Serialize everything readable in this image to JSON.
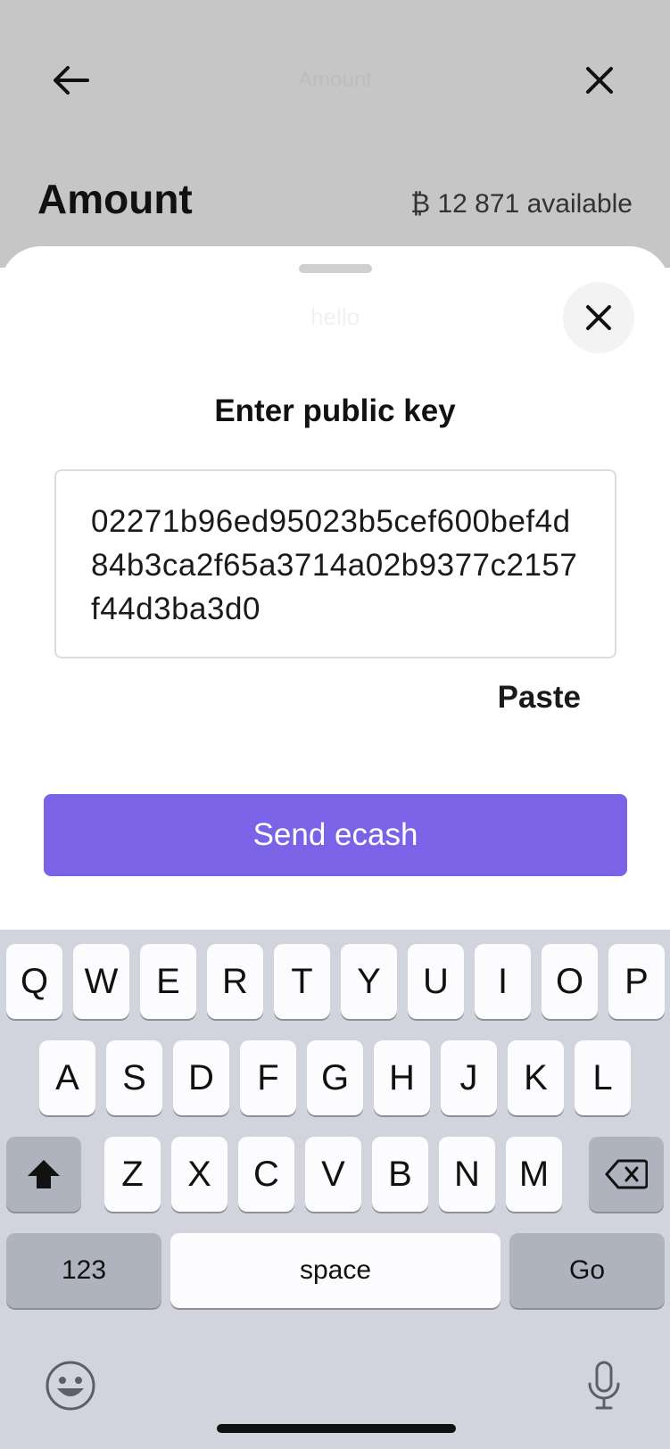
{
  "header": {
    "faded_title": "Amount",
    "title": "Amount",
    "available": "₿ 12 871 available",
    "back_icon": "arrow-left-icon",
    "close_icon": "close-icon"
  },
  "sheet": {
    "hint": "hello",
    "heading": "Enter public key",
    "public_key": "02271b96ed95023b5cef600bef4d84b3ca2f65a3714a02b9377c2157f44d3ba3d0",
    "paste_label": "Paste",
    "send_label": "Send ecash",
    "accent": "#7b63e7"
  },
  "keyboard": {
    "row1": [
      "Q",
      "W",
      "E",
      "R",
      "T",
      "Y",
      "U",
      "I",
      "O",
      "P"
    ],
    "row2": [
      "A",
      "S",
      "D",
      "F",
      "G",
      "H",
      "J",
      "K",
      "L"
    ],
    "row3": [
      "Z",
      "X",
      "C",
      "V",
      "B",
      "N",
      "M"
    ],
    "numbers_label": "123",
    "space_label": "space",
    "go_label": "Go",
    "shift_icon": "shift-icon",
    "backspace_icon": "backspace-icon",
    "emoji_icon": "emoji-icon",
    "mic_icon": "microphone-icon"
  }
}
